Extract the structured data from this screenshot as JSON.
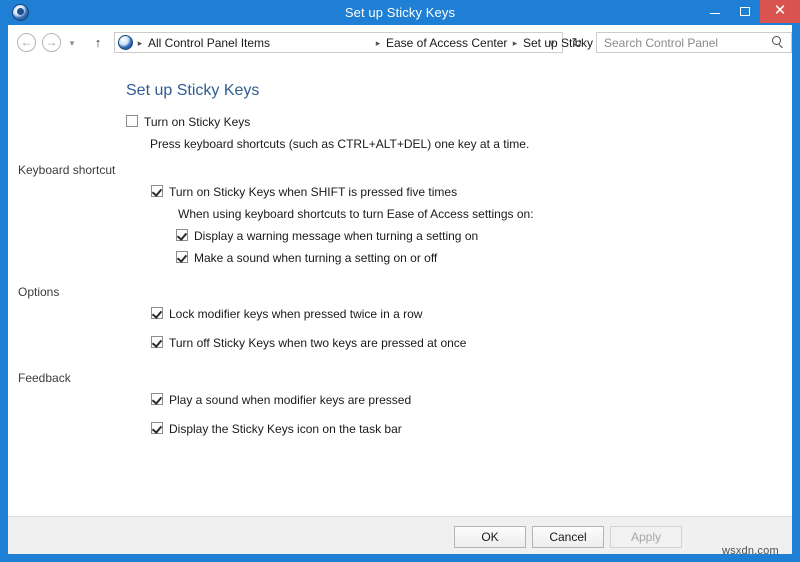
{
  "window": {
    "title": "Set up Sticky Keys",
    "title_icon": "ease-of-access-icon",
    "accent_color": "#1f7fd4",
    "close_color": "#d9534f",
    "controls": {
      "minimize": "–",
      "maximize": "□",
      "close": "✕"
    }
  },
  "navbar": {
    "back": "←",
    "forward": "→",
    "recent": "▾",
    "up": "↑",
    "refresh": "↻",
    "breadcrumb_dropdown": "∨",
    "separator": "▸",
    "breadcrumb": [
      "All Control Panel Items",
      "Ease of Access Center",
      "Set up Sticky Keys"
    ]
  },
  "search": {
    "placeholder": "Search Control Panel",
    "value": ""
  },
  "main": {
    "heading": "Set up Sticky Keys",
    "heading_color": "#2f5c94",
    "top_option": {
      "label": "Turn on Sticky Keys",
      "checked": false
    },
    "top_description": "Press keyboard shortcuts (such as CTRL+ALT+DEL) one key at a time.",
    "groups": [
      {
        "label": "Keyboard shortcut",
        "items": [
          {
            "label": "Turn on Sticky Keys when SHIFT is pressed five times",
            "checked": true
          },
          {
            "label": "Display a warning message when turning a setting on",
            "checked": true
          },
          {
            "label": "Make a sound when turning a setting on or off",
            "checked": true
          }
        ],
        "note": "When using keyboard shortcuts to turn Ease of Access settings on:"
      },
      {
        "label": "Options",
        "items": [
          {
            "label": "Lock modifier keys when pressed twice in a row",
            "checked": true
          },
          {
            "label": "Turn off Sticky Keys when two keys are pressed at once",
            "checked": true
          }
        ]
      },
      {
        "label": "Feedback",
        "items": [
          {
            "label": "Play a sound when modifier keys are pressed",
            "checked": true
          },
          {
            "label": "Display the Sticky Keys icon on the task bar",
            "checked": true
          }
        ]
      }
    ]
  },
  "footer": {
    "ok": "OK",
    "cancel": "Cancel",
    "apply": "Apply",
    "apply_enabled": false
  },
  "watermark": "wsxdn.com"
}
